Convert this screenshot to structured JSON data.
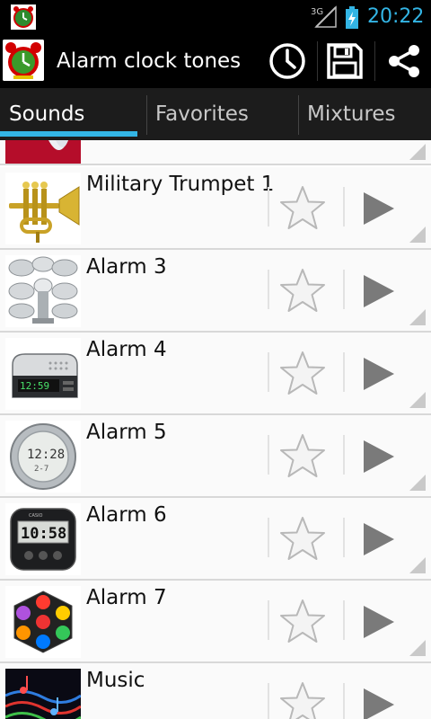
{
  "status_bar": {
    "network": "3G",
    "time": "20:22"
  },
  "action_bar": {
    "title": "Alarm clock tones",
    "icons": [
      "clock-icon",
      "save-icon",
      "share-icon"
    ]
  },
  "tabs": [
    {
      "label": "Sounds",
      "active": true
    },
    {
      "label": "Favorites",
      "active": false
    },
    {
      "label": "Mixtures",
      "active": false
    }
  ],
  "sounds": [
    {
      "title": "Military Trumpet 1",
      "thumb": "trumpet"
    },
    {
      "title": "Alarm 3",
      "thumb": "sirens"
    },
    {
      "title": "Alarm 4",
      "thumb": "clock-radio"
    },
    {
      "title": "Alarm 5",
      "thumb": "digital-round-clock"
    },
    {
      "title": "Alarm 6",
      "thumb": "travel-clock"
    },
    {
      "title": "Alarm 7",
      "thumb": "disco-lights"
    },
    {
      "title": "Music",
      "thumb": "music-notes"
    }
  ],
  "colors": {
    "accent": "#33b5e5",
    "row_background": "#fafafa",
    "divider": "#d8d8d8"
  }
}
